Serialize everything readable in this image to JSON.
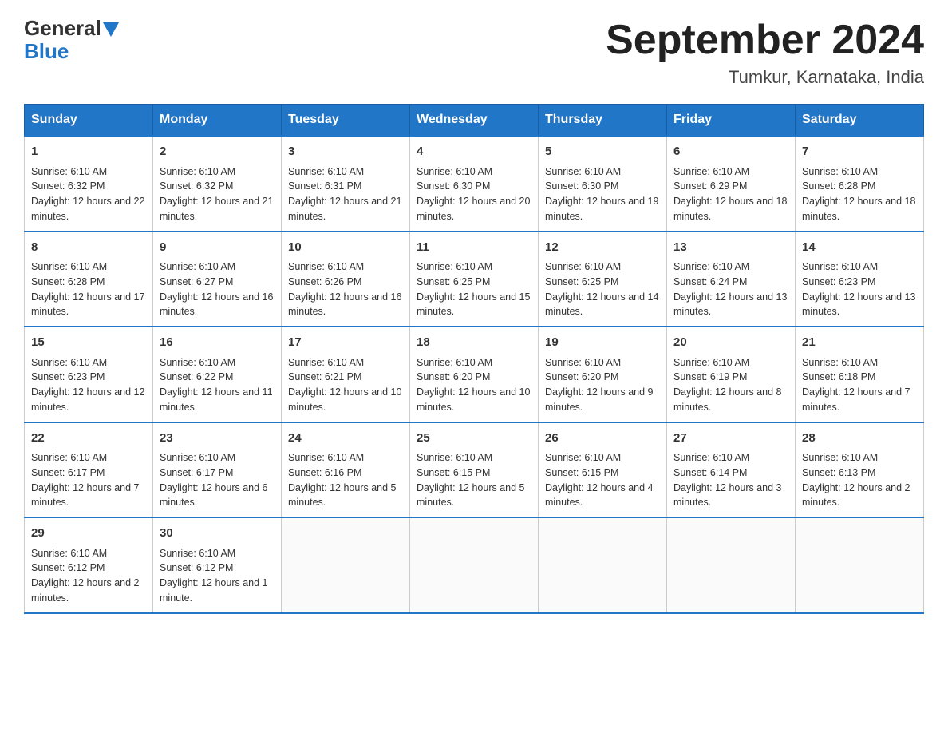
{
  "logo": {
    "general": "General",
    "blue": "Blue"
  },
  "header": {
    "title": "September 2024",
    "subtitle": "Tumkur, Karnataka, India"
  },
  "days_of_week": [
    "Sunday",
    "Monday",
    "Tuesday",
    "Wednesday",
    "Thursday",
    "Friday",
    "Saturday"
  ],
  "weeks": [
    [
      {
        "day": "1",
        "sunrise": "6:10 AM",
        "sunset": "6:32 PM",
        "daylight": "12 hours and 22 minutes."
      },
      {
        "day": "2",
        "sunrise": "6:10 AM",
        "sunset": "6:32 PM",
        "daylight": "12 hours and 21 minutes."
      },
      {
        "day": "3",
        "sunrise": "6:10 AM",
        "sunset": "6:31 PM",
        "daylight": "12 hours and 21 minutes."
      },
      {
        "day": "4",
        "sunrise": "6:10 AM",
        "sunset": "6:30 PM",
        "daylight": "12 hours and 20 minutes."
      },
      {
        "day": "5",
        "sunrise": "6:10 AM",
        "sunset": "6:30 PM",
        "daylight": "12 hours and 19 minutes."
      },
      {
        "day": "6",
        "sunrise": "6:10 AM",
        "sunset": "6:29 PM",
        "daylight": "12 hours and 18 minutes."
      },
      {
        "day": "7",
        "sunrise": "6:10 AM",
        "sunset": "6:28 PM",
        "daylight": "12 hours and 18 minutes."
      }
    ],
    [
      {
        "day": "8",
        "sunrise": "6:10 AM",
        "sunset": "6:28 PM",
        "daylight": "12 hours and 17 minutes."
      },
      {
        "day": "9",
        "sunrise": "6:10 AM",
        "sunset": "6:27 PM",
        "daylight": "12 hours and 16 minutes."
      },
      {
        "day": "10",
        "sunrise": "6:10 AM",
        "sunset": "6:26 PM",
        "daylight": "12 hours and 16 minutes."
      },
      {
        "day": "11",
        "sunrise": "6:10 AM",
        "sunset": "6:25 PM",
        "daylight": "12 hours and 15 minutes."
      },
      {
        "day": "12",
        "sunrise": "6:10 AM",
        "sunset": "6:25 PM",
        "daylight": "12 hours and 14 minutes."
      },
      {
        "day": "13",
        "sunrise": "6:10 AM",
        "sunset": "6:24 PM",
        "daylight": "12 hours and 13 minutes."
      },
      {
        "day": "14",
        "sunrise": "6:10 AM",
        "sunset": "6:23 PM",
        "daylight": "12 hours and 13 minutes."
      }
    ],
    [
      {
        "day": "15",
        "sunrise": "6:10 AM",
        "sunset": "6:23 PM",
        "daylight": "12 hours and 12 minutes."
      },
      {
        "day": "16",
        "sunrise": "6:10 AM",
        "sunset": "6:22 PM",
        "daylight": "12 hours and 11 minutes."
      },
      {
        "day": "17",
        "sunrise": "6:10 AM",
        "sunset": "6:21 PM",
        "daylight": "12 hours and 10 minutes."
      },
      {
        "day": "18",
        "sunrise": "6:10 AM",
        "sunset": "6:20 PM",
        "daylight": "12 hours and 10 minutes."
      },
      {
        "day": "19",
        "sunrise": "6:10 AM",
        "sunset": "6:20 PM",
        "daylight": "12 hours and 9 minutes."
      },
      {
        "day": "20",
        "sunrise": "6:10 AM",
        "sunset": "6:19 PM",
        "daylight": "12 hours and 8 minutes."
      },
      {
        "day": "21",
        "sunrise": "6:10 AM",
        "sunset": "6:18 PM",
        "daylight": "12 hours and 7 minutes."
      }
    ],
    [
      {
        "day": "22",
        "sunrise": "6:10 AM",
        "sunset": "6:17 PM",
        "daylight": "12 hours and 7 minutes."
      },
      {
        "day": "23",
        "sunrise": "6:10 AM",
        "sunset": "6:17 PM",
        "daylight": "12 hours and 6 minutes."
      },
      {
        "day": "24",
        "sunrise": "6:10 AM",
        "sunset": "6:16 PM",
        "daylight": "12 hours and 5 minutes."
      },
      {
        "day": "25",
        "sunrise": "6:10 AM",
        "sunset": "6:15 PM",
        "daylight": "12 hours and 5 minutes."
      },
      {
        "day": "26",
        "sunrise": "6:10 AM",
        "sunset": "6:15 PM",
        "daylight": "12 hours and 4 minutes."
      },
      {
        "day": "27",
        "sunrise": "6:10 AM",
        "sunset": "6:14 PM",
        "daylight": "12 hours and 3 minutes."
      },
      {
        "day": "28",
        "sunrise": "6:10 AM",
        "sunset": "6:13 PM",
        "daylight": "12 hours and 2 minutes."
      }
    ],
    [
      {
        "day": "29",
        "sunrise": "6:10 AM",
        "sunset": "6:12 PM",
        "daylight": "12 hours and 2 minutes."
      },
      {
        "day": "30",
        "sunrise": "6:10 AM",
        "sunset": "6:12 PM",
        "daylight": "12 hours and 1 minute."
      },
      null,
      null,
      null,
      null,
      null
    ]
  ]
}
